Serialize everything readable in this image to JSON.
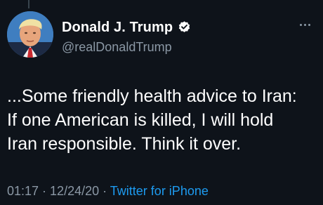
{
  "author": {
    "display_name": "Donald J. Trump",
    "handle": "@realDonaldTrump",
    "verified": true
  },
  "tweet": {
    "lines": [
      "...Some friendly health advice to Iran:",
      "If one American is killed, I will hold",
      "Iran responsible. Think it over."
    ]
  },
  "meta": {
    "time": "01:17",
    "separator1": " · ",
    "date": "12/24/20",
    "separator2": " · ",
    "source": "Twitter for iPhone"
  },
  "colors": {
    "background": "#0e131a",
    "text": "#ffffff",
    "secondary": "#8b98a5",
    "link": "#1d9bf0"
  },
  "icons": {
    "verified": "verified-badge-icon",
    "more": "more-options-icon"
  }
}
